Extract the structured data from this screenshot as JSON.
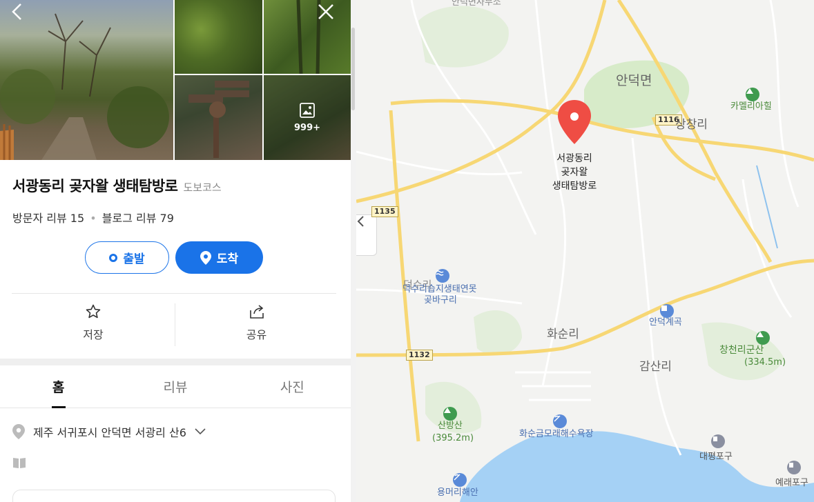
{
  "photos": {
    "more_count": "999+",
    "back_icon": "chevron-left-icon",
    "close_icon": "close-icon"
  },
  "place": {
    "name": "서광동리 곶자왈 생태탐방로",
    "category": "도보코스",
    "visitor_reviews_label": "방문자 리뷰",
    "visitor_reviews_count": "15",
    "separator": "•",
    "blog_reviews_label": "블로그 리뷰",
    "blog_reviews_count": "79"
  },
  "route": {
    "start_label": "출발",
    "end_label": "도착"
  },
  "actions": {
    "save_label": "저장",
    "share_label": "공유"
  },
  "tabs": [
    {
      "label": "홈",
      "active": true
    },
    {
      "label": "리뷰",
      "active": false
    },
    {
      "label": "사진",
      "active": false
    }
  ],
  "address": {
    "text": "제주 서귀포시 안덕면 서광리 산6"
  },
  "map": {
    "pin_label_lines": [
      "서광동리",
      "곶자왈",
      "생태탐방로"
    ],
    "areas": {
      "andeok": "안덕면",
      "sangchang": "상창리",
      "hwasun": "화순리",
      "gamsan": "감산리",
      "deoksu": "덕수리"
    },
    "pois": {
      "camellia": "카멜리아힐",
      "wetland_1": "덕수리습지생태연못",
      "wetland_2": "곶바구리",
      "valley": "안덕계곡",
      "changcheon_1": "창천리군산",
      "changcheon_2": "(334.5m)",
      "sanbang_1": "산방산",
      "sanbang_2": "(395.2m)",
      "beach": "화순금모래해수욕장",
      "daepyeong": "대평포구",
      "yerae": "예래포구",
      "yongmeori": "용머리해안",
      "top_cut": "안덕면사무소"
    },
    "roads": {
      "r1116": "1116",
      "r1135": "1135",
      "r1132": "1132"
    },
    "colors": {
      "road_main": "#f7d774",
      "road_minor": "#ffffff",
      "green_area": "#d7ebc9",
      "sea": "#a5d1f5",
      "pin": "#ef4d44",
      "accent": "#1a73e8"
    }
  }
}
